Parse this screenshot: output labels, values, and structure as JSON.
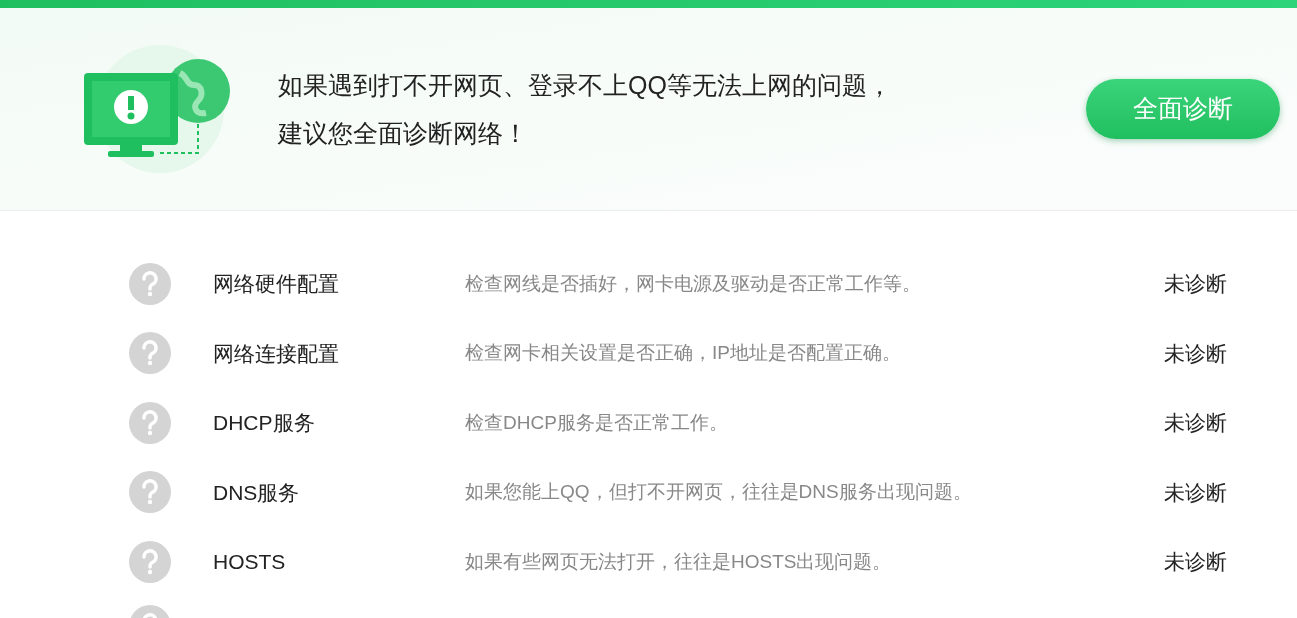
{
  "banner": {
    "message_lines": [
      "如果遇到打不开网页、登录不上QQ等无法上网的问题，",
      "建议您全面诊断网络！"
    ],
    "button": "全面诊断"
  },
  "checks": [
    {
      "name": "网络硬件配置",
      "description": "检查网线是否插好，网卡电源及驱动是否正常工作等。",
      "status": "未诊断"
    },
    {
      "name": "网络连接配置",
      "description": "检查网卡相关设置是否正确，IP地址是否配置正确。",
      "status": "未诊断"
    },
    {
      "name": "DHCP服务",
      "description": "检查DHCP服务是否正常工作。",
      "status": "未诊断"
    },
    {
      "name": "DNS服务",
      "description": "如果您能上QQ，但打不开网页，往往是DNS服务出现问题。",
      "status": "未诊断"
    },
    {
      "name": "HOSTS",
      "description": "如果有些网页无法打开，往往是HOSTS出现问题。",
      "status": "未诊断"
    }
  ]
}
